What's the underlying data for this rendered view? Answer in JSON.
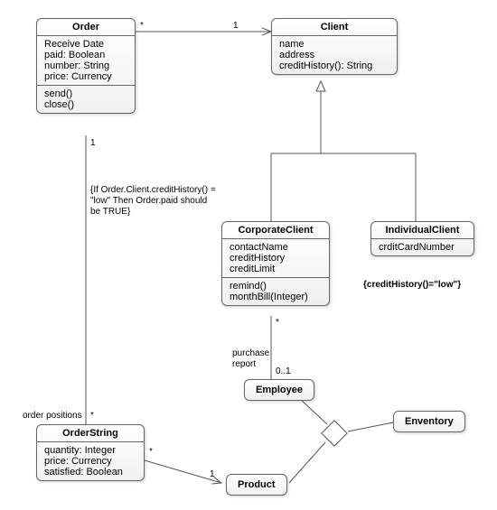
{
  "classes": {
    "order": {
      "title": "Order",
      "attrs": [
        "Receive Date",
        "paid: Boolean",
        "number: String",
        "price: Currency"
      ],
      "ops": [
        "send()",
        "close()"
      ]
    },
    "client": {
      "title": "Client",
      "attrs": [
        "name",
        "address",
        "creditHistory(): String"
      ]
    },
    "corporateClient": {
      "title": "CorporateClient",
      "attrs": [
        "contactName",
        "creditHistory",
        "creditLimit"
      ],
      "ops": [
        "remind()",
        "monthBill(Integer)"
      ]
    },
    "individualClient": {
      "title": "IndividualClient",
      "attrs": [
        "crditCardNumber"
      ]
    },
    "orderString": {
      "title": "OrderString",
      "attrs": [
        "quantity: Integer",
        "price: Currency",
        "satisfied: Boolean"
      ]
    },
    "employee": {
      "title": "Employee"
    },
    "product": {
      "title": "Product"
    },
    "enventory": {
      "title": "Enventory"
    }
  },
  "constraints": {
    "orderNote": "{If Order.Client.creditHistory() = \"low\" Then Order.paid should be TRUE}",
    "creditHistory": "{creditHistory()=\"low\"}"
  },
  "labels": {
    "orderPositions": "order positions",
    "purchaseReport": "purchase\nreport"
  },
  "mults": {
    "orderClientLeft": "*",
    "orderClientRight": "1",
    "orderOrderStringTop": "1",
    "orderOrderStringBottom": "*",
    "orderStringProductLeft": "*",
    "orderStringProductRight": "1",
    "corpEmpTop": "*",
    "corpEmpBottom": "0..1"
  }
}
